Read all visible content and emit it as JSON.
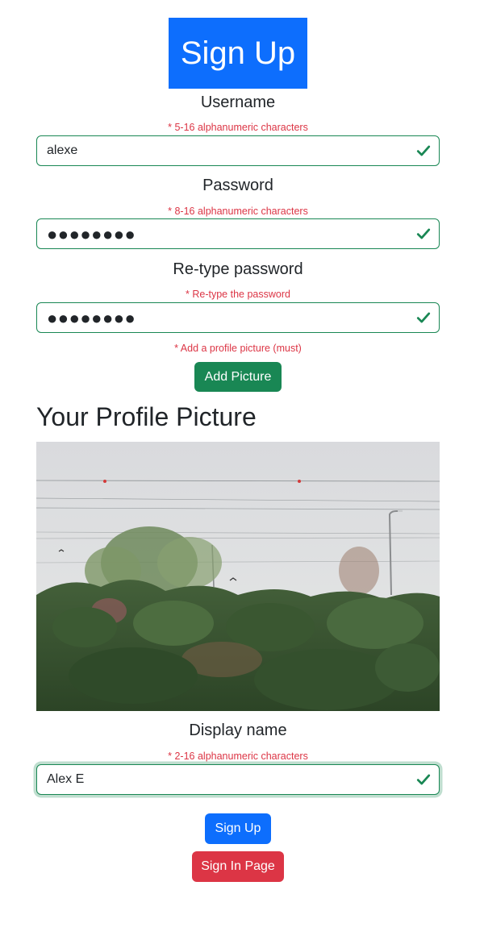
{
  "header": {
    "title": "Sign Up"
  },
  "username": {
    "label": "Username",
    "hint": "* 5-16 alphanumeric characters",
    "value": "alexe"
  },
  "password": {
    "label": "Password",
    "hint": "* 8-16 alphanumeric characters",
    "value": "●●●●●●●●"
  },
  "retype_password": {
    "label": "Re-type password",
    "hint": "* Re-type the password",
    "value": "●●●●●●●●"
  },
  "picture": {
    "hint": "* Add a profile picture (must)",
    "add_button": "Add Picture",
    "heading": "Your Profile Picture"
  },
  "display_name": {
    "label": "Display name",
    "hint": "* 2-16 alphanumeric characters",
    "value": "Alex E"
  },
  "actions": {
    "sign_up": "Sign Up",
    "sign_in_page": "Sign In Page"
  },
  "colors": {
    "primary": "#0d6efd",
    "success": "#198754",
    "danger": "#dc3545"
  },
  "icons": {
    "valid": "check-icon"
  }
}
